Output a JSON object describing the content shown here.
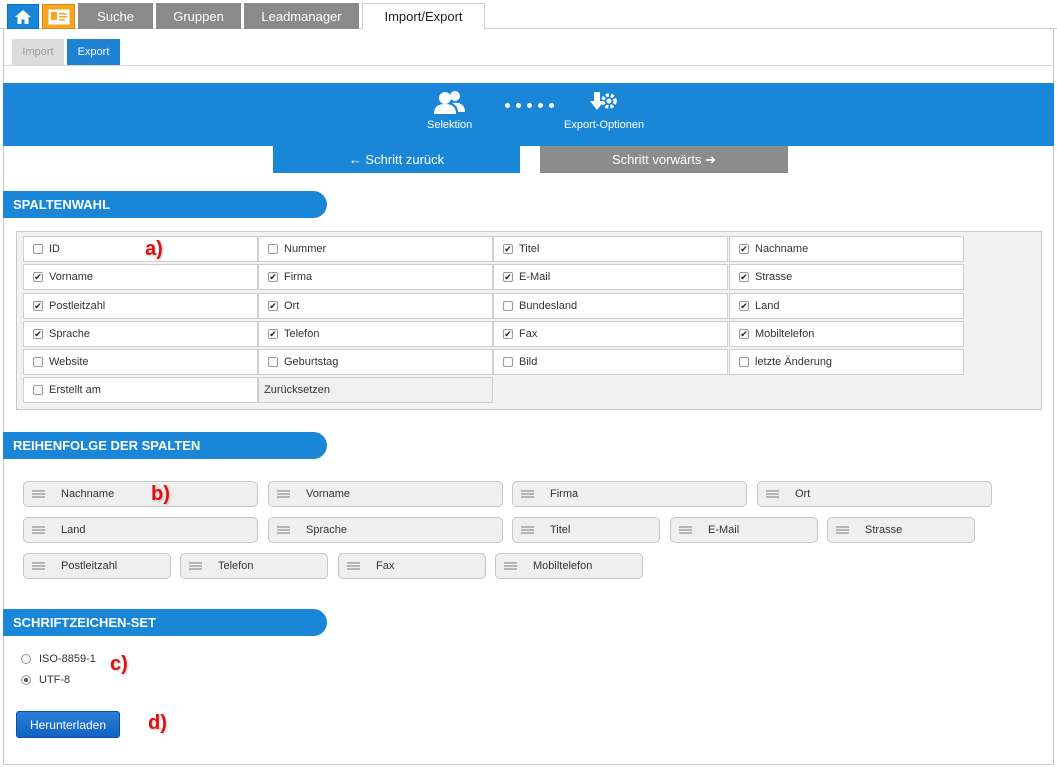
{
  "tabs": [
    "Suche",
    "Gruppen",
    "Leadmanager",
    "Import/Export"
  ],
  "subtabs": {
    "import": "Import",
    "export": "Export"
  },
  "wizard": {
    "step1": "Selektion",
    "step2": "Export-Optionen"
  },
  "nav": {
    "back": "← Schritt zurück",
    "forward": "Schritt vorwärts ➔"
  },
  "sections": {
    "columns": "SPALTENWAHL",
    "order": "REIHENFOLGE DER SPALTEN",
    "charset": "SCHRIFTZEICHEN-SET"
  },
  "columns": [
    {
      "label": "ID",
      "checked": false
    },
    {
      "label": "Nummer",
      "checked": false
    },
    {
      "label": "Titel",
      "checked": true
    },
    {
      "label": "Nachname",
      "checked": true
    },
    {
      "label": "Vorname",
      "checked": true
    },
    {
      "label": "Firma",
      "checked": true
    },
    {
      "label": "E-Mail",
      "checked": true
    },
    {
      "label": "Strasse",
      "checked": true
    },
    {
      "label": "Postleitzahl",
      "checked": true
    },
    {
      "label": "Ort",
      "checked": true
    },
    {
      "label": "Bundesland",
      "checked": false
    },
    {
      "label": "Land",
      "checked": true
    },
    {
      "label": "Sprache",
      "checked": true
    },
    {
      "label": "Telefon",
      "checked": true
    },
    {
      "label": "Fax",
      "checked": true
    },
    {
      "label": "Mobiltelefon",
      "checked": true
    },
    {
      "label": "Website",
      "checked": false
    },
    {
      "label": "Geburtstag",
      "checked": false
    },
    {
      "label": "Bild",
      "checked": false
    },
    {
      "label": "letzte Änderung",
      "checked": false
    },
    {
      "label": "Erstellt am",
      "checked": false
    }
  ],
  "reset_label": "Zurücksetzen",
  "order": [
    "Nachname",
    "Vorname",
    "Firma",
    "Ort",
    "Land",
    "Sprache",
    "Titel",
    "E-Mail",
    "Strasse",
    "Postleitzahl",
    "Telefon",
    "Fax",
    "Mobiltelefon"
  ],
  "charset": {
    "options": [
      {
        "label": "ISO-8859-1",
        "selected": false
      },
      {
        "label": "UTF-8",
        "selected": true
      }
    ]
  },
  "download_label": "Herunterladen",
  "annotations": [
    "a)",
    "b)",
    "c)",
    "d)"
  ],
  "colors": {
    "accent": "#1a86d8",
    "home": "#1a86d8",
    "card": "#f6a623",
    "inactive_tab": "#8a8a8a",
    "annotation": "#e01010"
  }
}
